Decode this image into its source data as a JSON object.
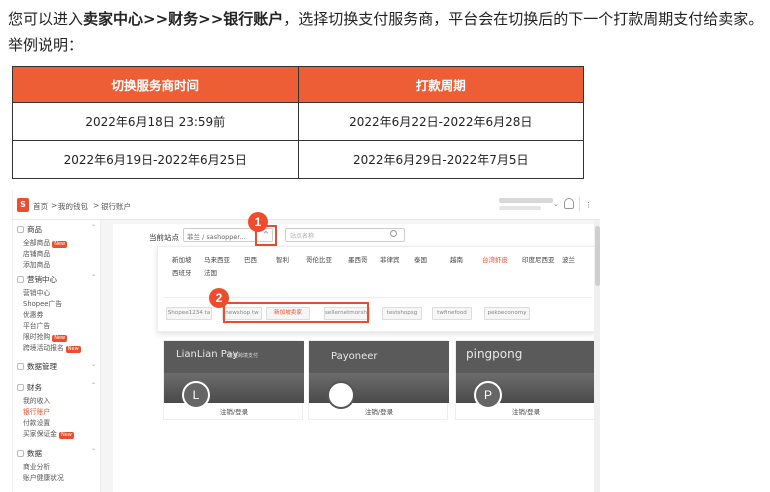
{
  "intro": {
    "p1": "您可以进入",
    "bold": "卖家中心>>财务>>银行账户",
    "p2": "，选择切换支付服务商，平台会在切换后的下一个打款周期支付给卖家。举例说明："
  },
  "schedule": {
    "headers": [
      "切换服务商时间",
      "打款周期"
    ],
    "rows": [
      [
        "2022年6月18日 23:59前",
        "2022年6月22日-2022年6月28日"
      ],
      [
        "2022年6月19日-2022年6月25日",
        "2022年6月29日-2022年7月5日"
      ]
    ]
  },
  "screenshot": {
    "brand_color": "#ee4d2d",
    "topbar": {
      "home": "首页",
      "sep1": ">",
      "wallet": "我的钱包",
      "sep2": ">",
      "page": "银行账户"
    },
    "sidebar": {
      "groups": [
        {
          "label": "商品",
          "items": [
            {
              "label": "全部商品",
              "badge": "New"
            },
            {
              "label": "店铺商品"
            },
            {
              "label": "添加商品"
            }
          ]
        },
        {
          "label": "营销中心",
          "items": [
            {
              "label": "营销中心"
            },
            {
              "label": "Shopee广告"
            },
            {
              "label": "优惠券"
            },
            {
              "label": "平台广告"
            },
            {
              "label": "限时抢购",
              "badge": "New"
            },
            {
              "label": "跨境活动报名",
              "badge": "New"
            }
          ]
        },
        {
          "label": "数据管理",
          "items": []
        },
        {
          "label": "财务",
          "items": [
            {
              "label": "我的收入"
            },
            {
              "label": "银行账户",
              "active": true
            },
            {
              "label": "付款设置"
            },
            {
              "label": "买家保证金",
              "badge": "New"
            }
          ]
        },
        {
          "label": "数据",
          "items": [
            {
              "label": "商业分析"
            },
            {
              "label": "账户健康状况"
            }
          ]
        }
      ]
    },
    "main": {
      "current_site_label": "当前站点",
      "current_site_value": "菲兰 / sashopper...",
      "chev": "^",
      "search_placeholder": "站点名称",
      "countries": [
        "新加坡",
        "马来西亚",
        "巴西",
        "智利",
        "哥伦比亚",
        "墨西哥",
        "菲律宾",
        "泰国",
        "越南",
        "台湾虾皮",
        "印度尼西亚",
        "波兰",
        "西班牙",
        "法国"
      ],
      "selected_country": "台湾虾皮",
      "chips": [
        "Shopee1234 ta",
        "newshop tw",
        "新加坡卖家",
        "sellernetmorshop",
        "testshopsg",
        "twfinefood",
        "pekoeconomy"
      ],
      "highlighted_chip": "新加坡卖家"
    },
    "markers": [
      "1",
      "2"
    ],
    "cards": [
      {
        "logo": "LianLian Pay",
        "sub": "连连跨境支付",
        "initial": "L",
        "action": "注销/登录"
      },
      {
        "logo": "Payoneer",
        "sub": "",
        "initial": "",
        "action": "注销/登录"
      },
      {
        "logo": "pingpong",
        "sub": "",
        "initial": "P",
        "action": "注销/登录"
      }
    ]
  }
}
